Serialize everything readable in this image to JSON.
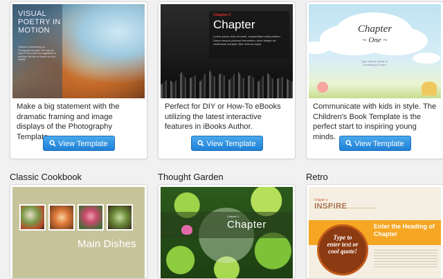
{
  "cards_top": [
    {
      "thumb_title": "VISUAL POETRY IN MOTION",
      "thumb_small": "Thanks for downloading our Photography Template. We hope you enjoy it! If you have any suggestions or feedback, feel free to contact us at our website.",
      "description": "Make a big statement with the dramatic framing and image displays of the Photography Template.",
      "button": "View Template"
    },
    {
      "thumb_chapter_label": "Chapter 1",
      "thumb_title": "Chapter",
      "thumb_small": "Lorem ipsum dolor sit amet, suspendisse nulla pretium. Donec tempor placerat fermentum, enim integer ad vestibulum volutpat. Nisl rhoncus turpis",
      "description": "Perfect for DIY or How-To eBooks utilizing the latest interactive features in iBooks Author.",
      "button": "View Template"
    },
    {
      "thumb_title": "Chapter",
      "thumb_subtitle": "~ One ~",
      "thumb_small": "Type a Book Quote or Something in Here",
      "description": "Communicate with kids in style. The Children's Book Template is the perfect start to inspiring young minds.",
      "button": "View Template"
    }
  ],
  "cards_bottom": [
    {
      "title": "Classic Cookbook",
      "thumb_title": "Main Dishes"
    },
    {
      "title": "Thought Garden",
      "thumb_chapter_label": "Chapter 1",
      "thumb_title": "Chapter"
    },
    {
      "title": "Retro",
      "thumb_chapter_label": "Chapter 1",
      "thumb_title": "INSPIRE",
      "thumb_heading": "Enter the Heading of Chapter",
      "thumb_quote": "Type to enter text or cool quote!"
    }
  ],
  "icons": {
    "button_icon": "search-icon"
  },
  "colors": {
    "button": "#2a8ee0",
    "retro_orange": "#f5a623",
    "retro_brown": "#8b3a12"
  }
}
